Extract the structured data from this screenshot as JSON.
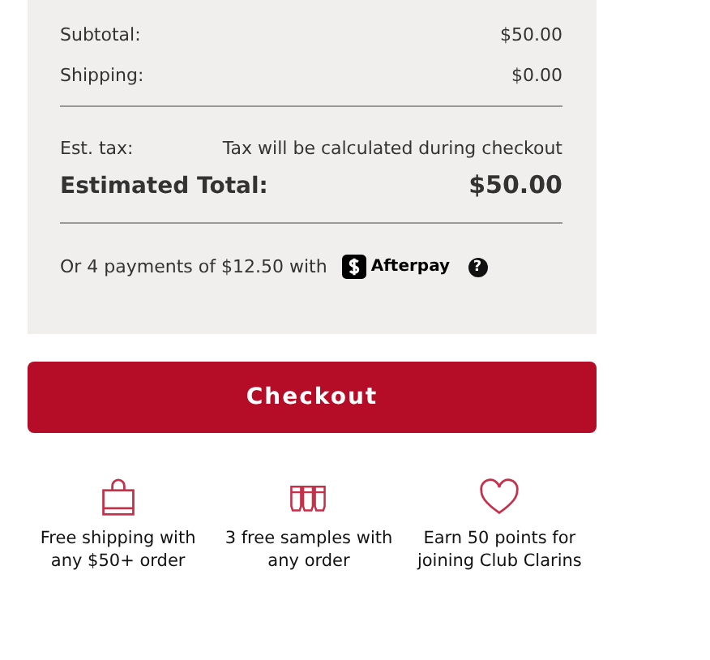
{
  "summary": {
    "rows": [
      {
        "label": "Subtotal:",
        "value": "$50.00"
      },
      {
        "label": "Shipping:",
        "value": "$0.00"
      }
    ],
    "tax": {
      "label": "Est. tax:",
      "value": "Tax will be calculated during checkout"
    },
    "total": {
      "label": "Estimated Total:",
      "value": "$50.00"
    },
    "installments": {
      "text": "Or 4 payments of $12.50 with",
      "brand": "Afterpay",
      "help": "?"
    }
  },
  "checkout_button": "Checkout",
  "perks": [
    {
      "kind": "bag",
      "text": "Free shipping with any $50+ order"
    },
    {
      "kind": "samples",
      "text": "3 free samples with any order"
    },
    {
      "kind": "heart",
      "text": "Earn 50 points for joining Club Clarins"
    }
  ]
}
